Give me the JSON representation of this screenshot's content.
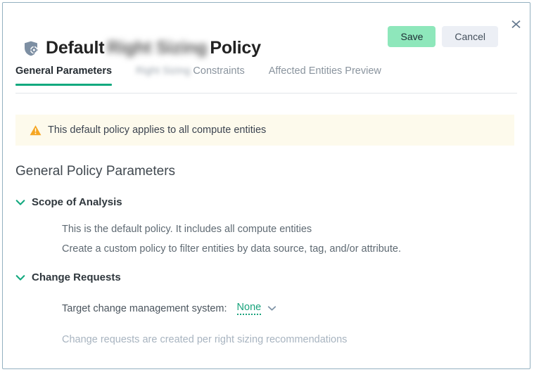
{
  "dialog": {
    "close_label": "close-icon",
    "border_color": "#93b0c0"
  },
  "header": {
    "icon": "shield-gear-icon",
    "title_prefix": "Default",
    "title_redacted": "Right Sizing",
    "title_suffix": "Policy",
    "save_label": "Save",
    "cancel_label": "Cancel",
    "save_color": "#8ee7bb",
    "cancel_color": "#eceff5"
  },
  "tabs": {
    "accent_color": "#13a97f",
    "items": [
      {
        "label": "General Parameters",
        "redacted_prefix": "",
        "active": true
      },
      {
        "label": "Constraints",
        "redacted_prefix": "Right Sizing",
        "active": false
      },
      {
        "label": "Affected Entities Preview",
        "redacted_prefix": "",
        "active": false
      }
    ]
  },
  "banner": {
    "icon": "warning-triangle-icon",
    "text": "This default policy applies to all compute entities",
    "background": "#fdfaec",
    "icon_color": "#f5a623"
  },
  "main": {
    "section_title": "General Policy Parameters",
    "groups": [
      {
        "label": "Scope of Analysis",
        "expanded": true,
        "lines": [
          "This is the default policy. It includes all compute entities",
          "Create a custom policy to filter entities by data source, tag, and/or attribute."
        ]
      },
      {
        "label": "Change Requests",
        "expanded": true,
        "field_label": "Target change management system:",
        "field_value": "None",
        "hint": "Change requests are created per right sizing recommendations"
      }
    ]
  }
}
